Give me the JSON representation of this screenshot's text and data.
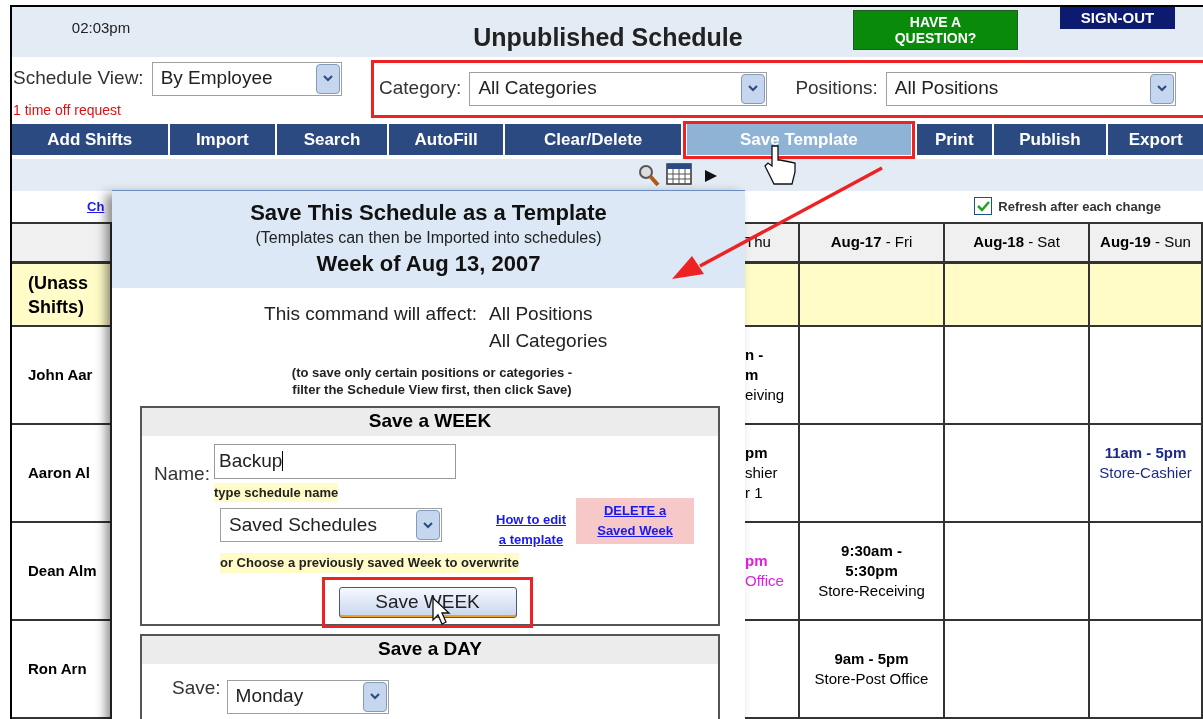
{
  "header": {
    "time": "02:03pm",
    "title": "Unpublished Schedule",
    "help_button": "HAVE A QUESTION?",
    "sign_out": "SIGN-OUT"
  },
  "filters": {
    "schedule_view": {
      "label": "Schedule View:",
      "value": "By Employee"
    },
    "notice": "1 time off request",
    "highlighted": true,
    "category": {
      "label": "Category:",
      "value": "All Categories"
    },
    "positions": {
      "label": "Positions:",
      "value": "All Positions"
    }
  },
  "toolbar": [
    {
      "label": "Add Shifts",
      "selected": false,
      "highlighted": false
    },
    {
      "label": "Import",
      "selected": false,
      "highlighted": false
    },
    {
      "label": "Search",
      "selected": false,
      "highlighted": false
    },
    {
      "label": "AutoFill",
      "selected": false,
      "highlighted": false
    },
    {
      "label": "Clear/Delete",
      "selected": false,
      "highlighted": false
    },
    {
      "label": "Save Template",
      "selected": true,
      "highlighted": true
    },
    {
      "label": "Print",
      "selected": false,
      "highlighted": false
    },
    {
      "label": "Publish",
      "selected": false,
      "highlighted": false
    },
    {
      "label": "Export",
      "selected": false,
      "highlighted": false
    }
  ],
  "change_link": "Ch",
  "refresh": {
    "label": "Refresh after each change",
    "checked": true
  },
  "schedule": {
    "columns": [
      {
        "kind": "partial",
        "label": "Thu"
      },
      {
        "kind": "day",
        "label": "**Aug-17** - Fri"
      },
      {
        "kind": "day",
        "label": "**Aug-18** - Sat"
      },
      {
        "kind": "day",
        "label": "**Aug-19** - Sun"
      }
    ],
    "rows": [
      {
        "kind": "unassigned",
        "name": [
          "(Unass",
          "Shifts)"
        ],
        "cells": [
          null,
          null,
          null,
          null
        ]
      },
      {
        "kind": "employee",
        "name": [
          "John Aar"
        ],
        "cells": [
          {
            "time": [
              "n -",
              "m"
            ],
            "position": [
              "eiving"
            ],
            "color": "#000000"
          },
          null,
          null,
          null
        ]
      },
      {
        "kind": "employee",
        "name": [
          "Aaron Al"
        ],
        "cells": [
          {
            "time": [
              "pm"
            ],
            "position": [
              "shier",
              "r 1"
            ],
            "color": "#000000"
          },
          null,
          null,
          {
            "time": [
              "11am - 5pm"
            ],
            "position": [
              "Store-Cashier"
            ],
            "color": "#1c2a8a"
          }
        ]
      },
      {
        "kind": "employee",
        "name": [
          "Dean Alm"
        ],
        "cells": [
          {
            "time": [
              "pm"
            ],
            "position": [
              "Office"
            ],
            "color": "#e020e0"
          },
          {
            "time": [
              "9:30am -",
              "5:30pm"
            ],
            "position": [
              "Store-Receiving"
            ],
            "color": "#000000"
          },
          null,
          null
        ]
      },
      {
        "kind": "employee",
        "name": [
          "Ron Arn"
        ],
        "cells": [
          null,
          {
            "time": [
              "9am - 5pm"
            ],
            "position": [
              "Store-Post Office"
            ],
            "color": "#000000"
          },
          null,
          null
        ]
      }
    ]
  },
  "dialog": {
    "title": "Save This Schedule as a Template",
    "subtitle": "(Templates can then be Imported into schedules)",
    "week": "Week of Aug 13, 2007",
    "affect_label": "This command will affect:",
    "affect_values": [
      "All Positions",
      "All Categories"
    ],
    "note": [
      "(to save only certain positions or categories -",
      "filter the Schedule View first, then click Save)"
    ],
    "week_section": {
      "heading": "Save a WEEK",
      "name_label": "Name:",
      "name_value": "Backup",
      "name_hint": "type schedule name",
      "saved_select": "Saved Schedules",
      "help_link": [
        "How to edit",
        "a template"
      ],
      "delete_link": [
        "DELETE a",
        "Saved Week"
      ],
      "overwrite_hint": "or Choose a previously saved Week to overwrite",
      "button": "Save WEEK",
      "highlighted": true
    },
    "day_section": {
      "heading": "Save a DAY",
      "save_label": "Save:",
      "day_value": "Monday"
    }
  }
}
